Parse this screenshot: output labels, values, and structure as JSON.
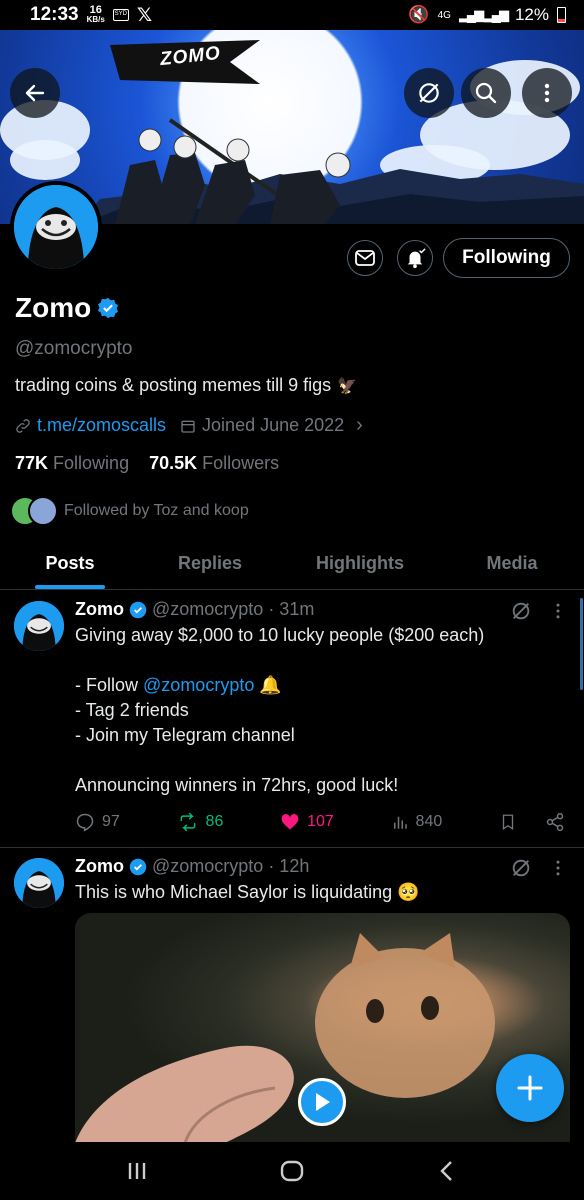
{
  "status_bar": {
    "time": "12:33",
    "speed_value": "16",
    "speed_unit": "KB/s",
    "network": "4G",
    "battery": "12%"
  },
  "banner": {
    "flag_text": "ZOMO"
  },
  "profile": {
    "display_name": "Zomo",
    "handle": "@zomocrypto",
    "bio": "trading coins & posting memes till 9 figs",
    "link": "t.me/zomoscalls",
    "joined": "Joined June 2022",
    "following_count": "77K",
    "following_label": "Following",
    "followers_count": "70.5K",
    "followers_label": "Followers",
    "followed_by": "Followed by Toz and koop",
    "follow_button": "Following"
  },
  "tabs": [
    {
      "label": "Posts",
      "active": true
    },
    {
      "label": "Replies"
    },
    {
      "label": "Highlights"
    },
    {
      "label": "Media"
    }
  ],
  "tweets": [
    {
      "name": "Zomo",
      "handle": "@zomocrypto",
      "time": "· 31m",
      "line1": "Giving away $2,000 to 10 lucky people ($200 each)",
      "line2_prefix": "- Follow",
      "line2_mention": "@zomocrypto",
      "line3": "- Tag 2 friends",
      "line4": "- Join my Telegram channel",
      "line5": "Announcing winners in 72hrs, good luck!",
      "replies": "97",
      "reposts": "86",
      "likes": "107",
      "views": "840"
    },
    {
      "name": "Zomo",
      "handle": "@zomocrypto",
      "time": "· 12h",
      "line1": "This is who Michael Saylor is liquidating"
    }
  ],
  "colors": {
    "accent": "#1d9bf0",
    "repost": "#00ba7c",
    "like": "#f91880",
    "muted": "#71767b"
  }
}
